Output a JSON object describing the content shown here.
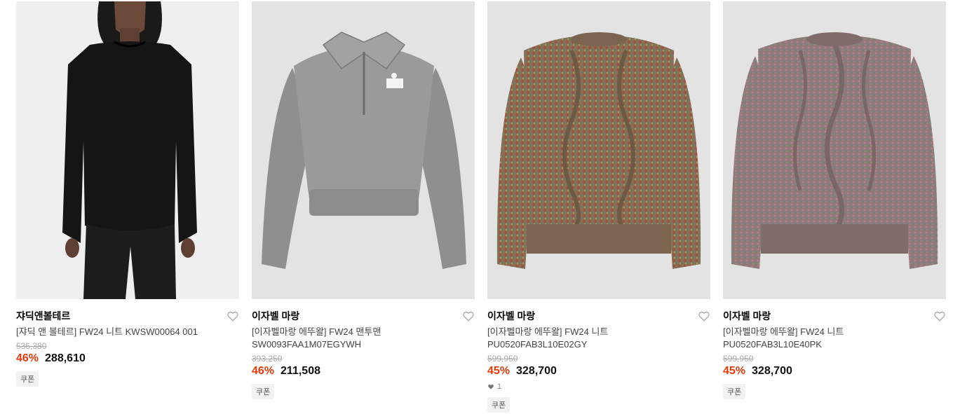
{
  "products": [
    {
      "brand": "쟈딕앤볼테르",
      "name": "[쟈딕 앤 볼테르] FW24 니트 KWSW00064 001",
      "original_price": "536,380",
      "discount": "46%",
      "price": "288,610",
      "coupon": "쿠폰",
      "image_icon": "black-sweater-model-image"
    },
    {
      "brand": "이자벨 마랑",
      "name": "[이자벨마랑 에뚜왈] FW24 맨투맨\nSW0093FAA1M07EGYWH",
      "original_price": "393,250",
      "discount": "46%",
      "price": "211,508",
      "coupon": "쿠폰",
      "image_icon": "grey-half-zip-sweatshirt-image"
    },
    {
      "brand": "이자벨 마랑",
      "name": "[이자벨마랑 에뚜왈] FW24 니트\nPU0520FAB3L10E02GY",
      "original_price": "599,950",
      "discount": "45%",
      "price": "328,700",
      "likes": "1",
      "coupon": "쿠폰",
      "image_icon": "multicolor-cable-knit-sweater-image"
    },
    {
      "brand": "이자벨 마랑",
      "name": "[이자벨마랑 에뚜왈] FW24 니트\nPU0520FAB3L10E40PK",
      "original_price": "599,950",
      "discount": "45%",
      "price": "328,700",
      "coupon": "쿠폰",
      "image_icon": "pink-cable-knit-sweater-image"
    }
  ],
  "colors": {
    "discount": "#e8380d",
    "image_bg": "#e5e5e5"
  }
}
